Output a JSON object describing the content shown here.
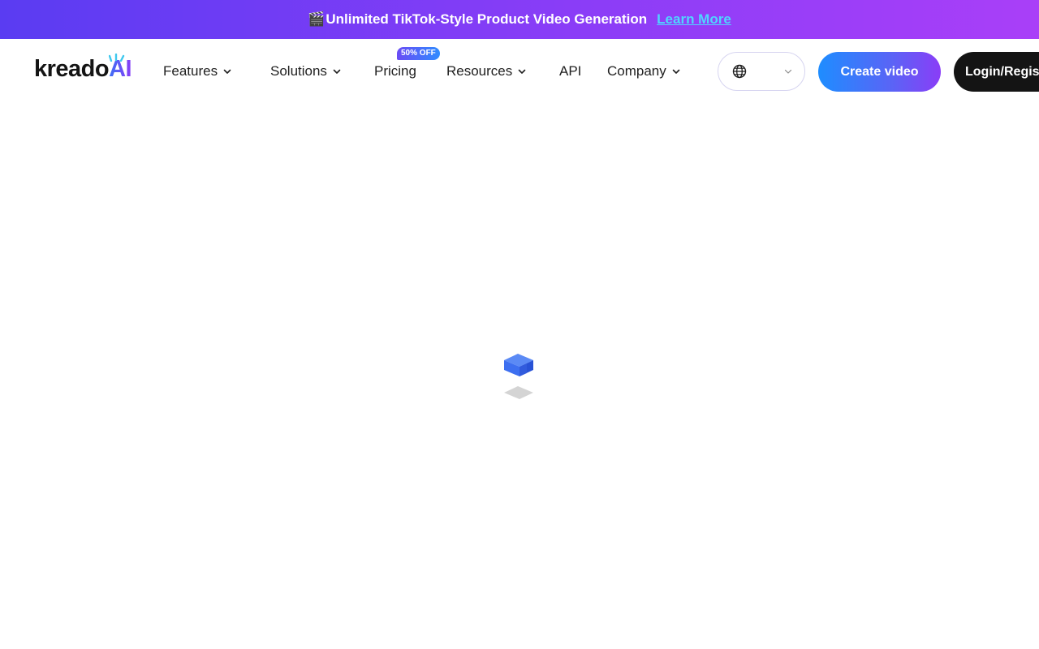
{
  "promo": {
    "emoji": "🎬",
    "text": "Unlimited TikTok-Style Product Video Generation",
    "link_label": "Learn More"
  },
  "logo": {
    "text_main": "kreado",
    "text_ai": "AI"
  },
  "nav": {
    "items": [
      {
        "label": "Features",
        "has_dropdown": true
      },
      {
        "label": "Solutions",
        "has_dropdown": true
      },
      {
        "label": "Pricing",
        "has_dropdown": false,
        "badge": "50% OFF"
      },
      {
        "label": "Resources",
        "has_dropdown": true
      },
      {
        "label": "API",
        "has_dropdown": false
      },
      {
        "label": "Company",
        "has_dropdown": true
      }
    ],
    "language_icon": "globe-icon",
    "create_label": "Create video",
    "login_label": "Login/Register"
  },
  "colors": {
    "brand_blue": "#1e8dff",
    "brand_purple": "#8a3df7",
    "link_cyan": "#4fd5ff",
    "loader_blue": "#3d6ff0"
  }
}
